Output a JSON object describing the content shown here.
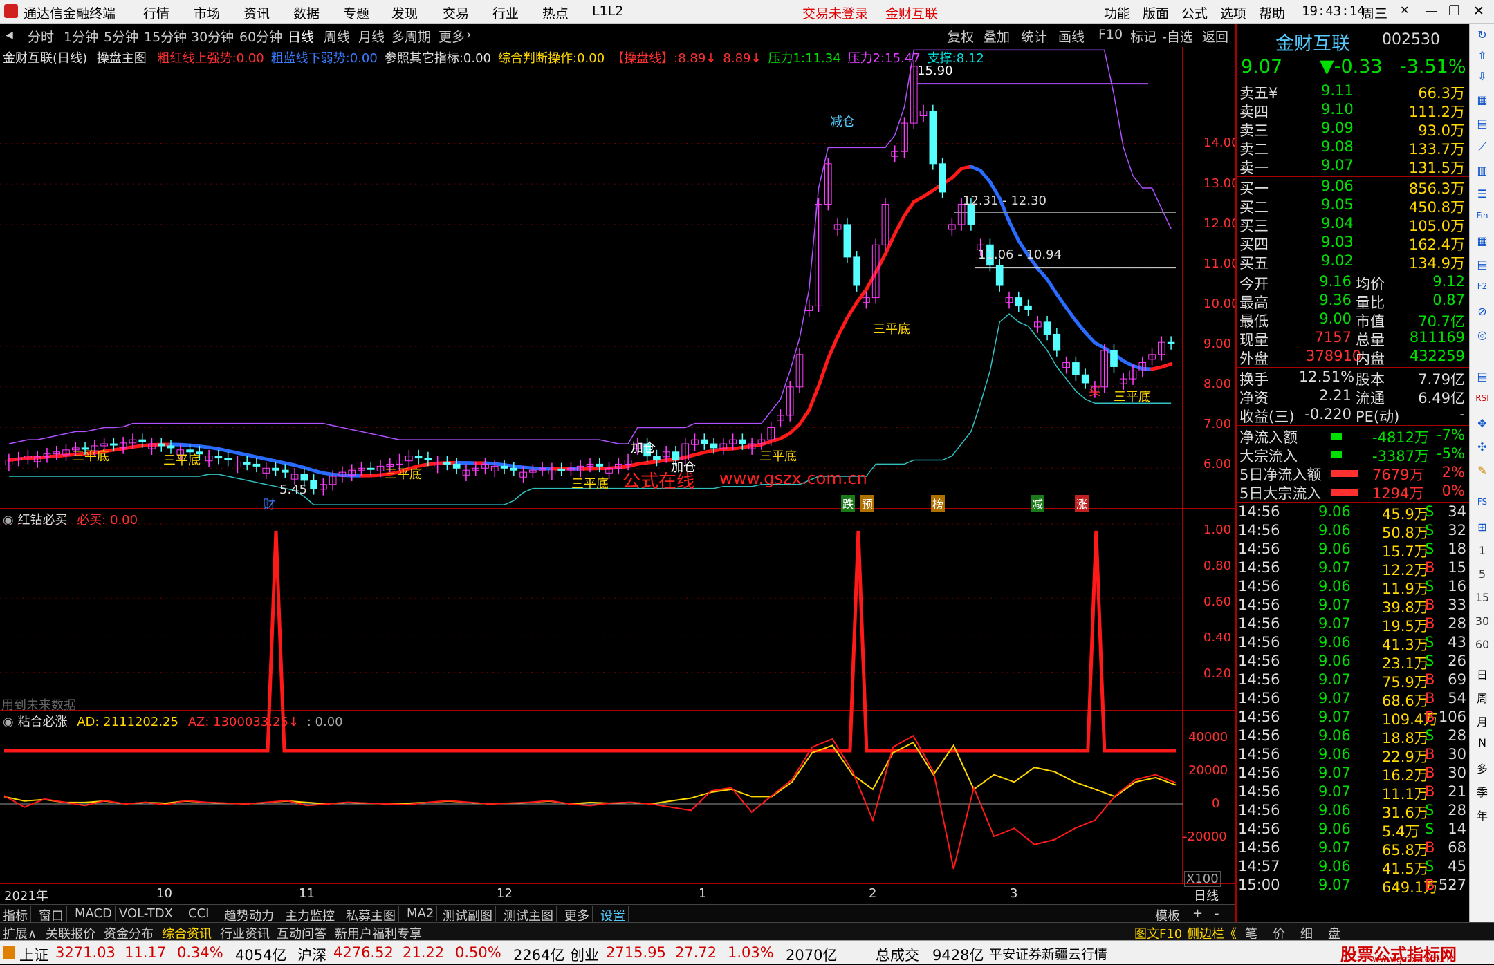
{
  "app": {
    "title": "通达信金融终端",
    "menus": [
      "行情",
      "市场",
      "资讯",
      "数据",
      "专题",
      "发现",
      "交易",
      "行业",
      "热点",
      "L1L2"
    ],
    "center": [
      "交易未登录",
      "金财互联"
    ],
    "right_menus": [
      "功能",
      "版面",
      "公式",
      "选项",
      "帮助"
    ],
    "time": "19:43:14",
    "weekday": "周三"
  },
  "toolbar": {
    "periods": [
      "分时",
      "1分钟",
      "5分钟",
      "15分钟",
      "30分钟",
      "60分钟",
      "日线",
      "周线",
      "月线",
      "多周期",
      "更多"
    ],
    "active": "日线",
    "actions": [
      "复权",
      "叠加",
      "统计",
      "画线",
      "F10",
      "标记",
      "-自选",
      "返回"
    ]
  },
  "main_header": {
    "stock": "金财互联(日线)",
    "indicator": "操盘主图",
    "items": [
      {
        "label": "粗红线上强势:",
        "value": "0.00",
        "color": "#ff3030"
      },
      {
        "label": "粗蓝线下弱势:",
        "value": "0.00",
        "color": "#3a7cff"
      },
      {
        "label": "参照其它指标:",
        "value": "0.00",
        "color": "#e0e0e0"
      },
      {
        "label": "综合判断操作:",
        "value": "0.00",
        "color": "#ffd700"
      },
      {
        "label": "【操盘线】:",
        "value": "8.89↓",
        "color": "#ff3030"
      },
      {
        "label": "",
        "value": "8.89↓",
        "color": "#ff3030"
      },
      {
        "label": "压力1:",
        "value": "11.34",
        "color": "#00e000"
      },
      {
        "label": "压力2:",
        "value": "15.47",
        "color": "#e040ff"
      },
      {
        "label": "支撑:",
        "value": "8.12",
        "color": "#00e0e0"
      }
    ]
  },
  "annotations": {
    "top": "15.90",
    "r1": "12.31 - 12.30",
    "r2": "11.06 - 10.94",
    "low": "5.45",
    "sanpingdi": "三平底",
    "jiacang": "加仓",
    "jiancang": "减仓",
    "mai": "买",
    "chai": "财",
    "watermark_cn": "公式在线",
    "watermark_url": "www.gszx.com.cn",
    "events": [
      "跌",
      "预",
      "榜",
      "减",
      "涨"
    ]
  },
  "price_axis": [
    "14.00",
    "13.00",
    "12.00",
    "11.00",
    "10.00",
    "9.00",
    "8.00",
    "7.00",
    "6.00"
  ],
  "panel2": {
    "title": "红钻必买",
    "label": "必买:",
    "value": "0.00",
    "note": "用到未来数据",
    "axis": [
      "1.00",
      "0.80",
      "0.60",
      "0.40",
      "0.20"
    ]
  },
  "panel3": {
    "title": "粘合必涨",
    "ad_label": "AD:",
    "ad": "2111202.25",
    "az_label": "AZ:",
    "az": "1300033.25↓",
    "extra": ": 0.00",
    "axis": [
      "40000",
      "20000",
      "0",
      "-20000"
    ],
    "unit": "X100"
  },
  "date_axis": [
    "2021年",
    "10",
    "11",
    "12",
    "1",
    "2",
    "3"
  ],
  "bottom_tabs": [
    "指标",
    "窗口",
    "MACD",
    "VOL-TDX",
    "CCI",
    "趋势动力",
    "主力监控",
    "私募主图",
    "MA2",
    "测试副图",
    "测试主图",
    "更多",
    "设置"
  ],
  "bottom_right": [
    "模板",
    "+",
    "-"
  ],
  "ext_tabs": [
    "扩展∧",
    "关联报价",
    "资金分布",
    "综合资讯",
    "行业资讯",
    "互动问答",
    "新用户福利专享"
  ],
  "ext_right": [
    "图文F10",
    "侧边栏《",
    "笔",
    "价",
    "细",
    "盘"
  ],
  "quote": {
    "name": "金财互联",
    "code": "002530",
    "price": "9.07",
    "change": "▼-0.33",
    "pct": "-3.51%",
    "asks": [
      [
        "卖五¥",
        "9.11",
        "66.3万"
      ],
      [
        "卖四",
        "9.10",
        "111.2万"
      ],
      [
        "卖三",
        "9.09",
        "93.0万"
      ],
      [
        "卖二",
        "9.08",
        "133.7万"
      ],
      [
        "卖一",
        "9.07",
        "131.5万"
      ]
    ],
    "bids": [
      [
        "买一",
        "9.06",
        "856.3万"
      ],
      [
        "买二",
        "9.05",
        "450.8万"
      ],
      [
        "买三",
        "9.04",
        "105.0万"
      ],
      [
        "买四",
        "9.03",
        "162.4万"
      ],
      [
        "买五",
        "9.02",
        "134.9万"
      ]
    ],
    "stats": [
      [
        "今开",
        "9.16",
        "均价",
        "9.12"
      ],
      [
        "最高",
        "9.36",
        "量比",
        "0.87"
      ],
      [
        "最低",
        "9.00",
        "市值",
        "70.7亿"
      ],
      [
        "现量",
        "7157",
        "总量",
        "811169"
      ],
      [
        "外盘",
        "378910",
        "内盘",
        "432259"
      ]
    ],
    "stats2": [
      [
        "换手",
        "12.51%",
        "股本",
        "7.79亿"
      ],
      [
        "净资",
        "2.21",
        "流通",
        "6.49亿"
      ],
      [
        "收益(三)",
        "-0.220",
        "PE(动)",
        "-"
      ]
    ],
    "flows": [
      [
        "净流入额",
        "-4812万",
        "-7%"
      ],
      [
        "大宗流入",
        "-3387万",
        "-5%"
      ],
      [
        "5日净流入额",
        "7679万",
        "2%"
      ],
      [
        "5日大宗流入",
        "1294万",
        "0%"
      ]
    ],
    "ticks": [
      [
        "14:56",
        "9.06",
        "45.9万",
        "S",
        "34"
      ],
      [
        "14:56",
        "9.06",
        "50.8万",
        "S",
        "32"
      ],
      [
        "14:56",
        "9.06",
        "15.7万",
        "S",
        "18"
      ],
      [
        "14:56",
        "9.07",
        "12.2万",
        "B",
        "15"
      ],
      [
        "14:56",
        "9.06",
        "11.9万",
        "S",
        "16"
      ],
      [
        "14:56",
        "9.07",
        "39.8万",
        "B",
        "33"
      ],
      [
        "14:56",
        "9.07",
        "19.5万",
        "B",
        "28"
      ],
      [
        "14:56",
        "9.06",
        "41.3万",
        "S",
        "43"
      ],
      [
        "14:56",
        "9.06",
        "23.1万",
        "S",
        "26"
      ],
      [
        "14:56",
        "9.07",
        "75.9万",
        "B",
        "69"
      ],
      [
        "14:56",
        "9.07",
        "68.6万",
        "B",
        "54"
      ],
      [
        "14:56",
        "9.07",
        "109.4万",
        "B",
        "106"
      ],
      [
        "14:56",
        "9.06",
        "18.8万",
        "S",
        "28"
      ],
      [
        "14:56",
        "9.06",
        "22.9万",
        "B",
        "30"
      ],
      [
        "14:56",
        "9.07",
        "16.2万",
        "B",
        "30"
      ],
      [
        "14:56",
        "9.07",
        "11.1万",
        "B",
        "21"
      ],
      [
        "14:56",
        "9.06",
        "31.6万",
        "S",
        "28"
      ],
      [
        "14:56",
        "9.06",
        "5.4万",
        "S",
        "14"
      ],
      [
        "14:56",
        "9.07",
        "65.8万",
        "B",
        "68"
      ],
      [
        "14:57",
        "9.06",
        "41.5万",
        "S",
        "45"
      ],
      [
        "15:00",
        "9.07",
        "649.1万",
        "B",
        "527"
      ]
    ]
  },
  "sidebar": [
    "日",
    "周",
    "月",
    "N",
    "多",
    "季",
    "年"
  ],
  "status": [
    [
      "上证",
      "3271.03",
      "11.17",
      "0.34%",
      "4054亿"
    ],
    [
      "沪深",
      "4276.52",
      "21.22",
      "0.50%",
      "2264亿"
    ],
    [
      "创业",
      "2715.95",
      "27.72",
      "1.03%",
      "2070亿"
    ]
  ],
  "status_total": [
    "总成交",
    "9428亿"
  ],
  "status_broker": "平安证券新疆云行情",
  "status_brand": "股票公式指标网",
  "status_url": "www.gszx.com.cn",
  "chart_data": {
    "type": "candlestick",
    "price_range": [
      5.0,
      16.0
    ],
    "closes": [
      6.2,
      6.25,
      6.3,
      6.28,
      6.35,
      6.4,
      6.45,
      6.5,
      6.48,
      6.55,
      6.6,
      6.58,
      6.62,
      6.7,
      6.65,
      6.6,
      6.55,
      6.5,
      6.45,
      6.4,
      6.35,
      6.3,
      6.25,
      6.2,
      6.15,
      6.1,
      6.05,
      6.0,
      5.95,
      5.9,
      5.85,
      5.7,
      5.5,
      5.6,
      5.8,
      5.9,
      5.95,
      6.0,
      5.98,
      6.05,
      6.1,
      6.2,
      6.3,
      6.25,
      6.2,
      6.15,
      6.1,
      6.0,
      5.95,
      6.0,
      6.1,
      6.05,
      6.0,
      5.95,
      5.9,
      5.95,
      6.0,
      5.98,
      5.95,
      6.0,
      6.05,
      6.1,
      6.05,
      6.0,
      6.1,
      6.2,
      6.6,
      6.3,
      6.2,
      6.4,
      6.2,
      6.6,
      6.7,
      6.6,
      6.5,
      6.6,
      6.7,
      6.6,
      6.6,
      6.7,
      7.0,
      7.3,
      8.0,
      8.8,
      10.0,
      12.5,
      13.5,
      12.0,
      11.2,
      10.5,
      10.2,
      11.5,
      12.5,
      13.8,
      14.5,
      15.9,
      14.8,
      13.5,
      12.8,
      12.0,
      12.5,
      12.0,
      11.5,
      11.0,
      10.5,
      10.2,
      10.0,
      9.9,
      9.6,
      9.3,
      8.9,
      8.6,
      8.3,
      8.1,
      8.0,
      8.9,
      8.5,
      8.2,
      8.4,
      8.6,
      8.8,
      9.1,
      9.07
    ],
    "red_signals": [
      0.232,
      0.729,
      0.932
    ],
    "ad_series": [
      5000,
      -2000,
      3000,
      1000,
      -1000,
      2000,
      0,
      1000,
      -500,
      2000,
      1000,
      500,
      0,
      1000,
      2000,
      -1000,
      0,
      1000,
      500,
      0,
      -500,
      1000,
      2000,
      1000,
      0,
      500,
      1000,
      2000,
      0,
      -1000,
      500,
      1000,
      0,
      -2000,
      -4000,
      8000,
      10000,
      -5000,
      5000,
      15000,
      35000,
      40000,
      20000,
      -10000,
      35000,
      42000,
      20000,
      -40000,
      10000,
      -20000,
      -15000,
      -25000,
      -22000,
      -15000,
      -10000,
      5000,
      15000,
      18000,
      13000
    ]
  }
}
